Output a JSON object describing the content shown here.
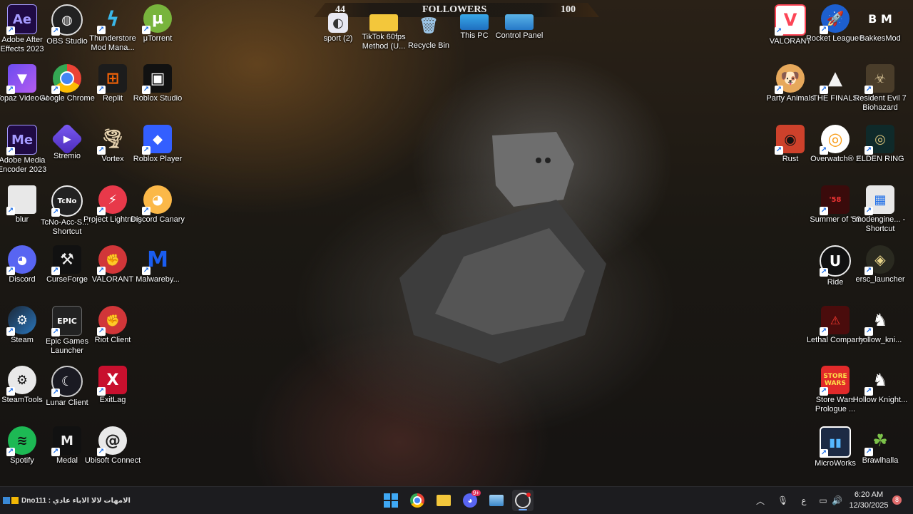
{
  "followers_bar": {
    "left": "44",
    "title": "FOLLOWERS",
    "right": "100"
  },
  "desktop_icons": {
    "ae": "Adobe After Effects 2023",
    "obs": "OBS Studio",
    "thunderstore": "Thunderstore Mod Mana...",
    "utorrent": "μTorrent",
    "sport": "sport (2)",
    "tiktok": "TikTok 60fps Method (U...",
    "recycle": "Recycle Bin",
    "thispc": "This PC",
    "controlpanel": "Control Panel",
    "valorant_top": "VALORANT",
    "rocket": "Rocket League®",
    "bakkes": "BakkesMod",
    "topaz": "Topaz Video AI",
    "chrome": "Google Chrome",
    "replit": "Replit",
    "roblox_studio": "Roblox Studio",
    "party": "Party Animals",
    "finals": "THE FINALS",
    "re7": "Resident Evil 7 Biohazard",
    "me": "Adobe Media Encoder 2023",
    "stremio": "Stremio",
    "vortex": "Vortex",
    "roblox_player": "Roblox Player",
    "rust": "Rust",
    "overwatch": "Overwatch® 2",
    "elden": "ELDEN RING",
    "blur": "blur",
    "tcno": "TcNo-Acc-S... - Shortcut",
    "lightning": "Project Lightning",
    "canary": "Discord Canary",
    "summer": "Summer of '58",
    "modengine": "modengine... - Shortcut",
    "discord": "Discord",
    "curseforge": "CurseForge",
    "valorant2": "VALORANT",
    "malwarebytes": "Malwareby...",
    "ride": "Ride",
    "ersc": "ersc_launcher",
    "steam": "Steam",
    "epic": "Epic Games Launcher",
    "riot": "Riot Client",
    "lethal": "Lethal Company",
    "hollow_kni": "hollow_kni...",
    "steamtools": "SteamTools",
    "lunar": "Lunar Client",
    "exitlag": "ExitLag",
    "storewars": "Store Wars Prologue ...",
    "hollow": "Hollow Knight...",
    "spotify": "Spotify",
    "medal": "Medal",
    "ubisoft": "Ubisoft Connect",
    "microworks": "MicroWorks",
    "brawlhalla": "Brawlhalla"
  },
  "icon_glyphs": {
    "ae": "Ae",
    "me": "Me",
    "epic": "EPIC",
    "utorrent": "µ",
    "b_m": "B M"
  },
  "taskbar": {
    "widget_text": "Dno111 : الامهات لالا الاباء عادي",
    "discord_badge": "9+",
    "time": "6:20 AM",
    "date": "12/30/2025",
    "lang": "ع",
    "notif_count": "8"
  },
  "colors": {
    "accent": "#1d6ee8",
    "taskbar": "#1c1c1f"
  }
}
